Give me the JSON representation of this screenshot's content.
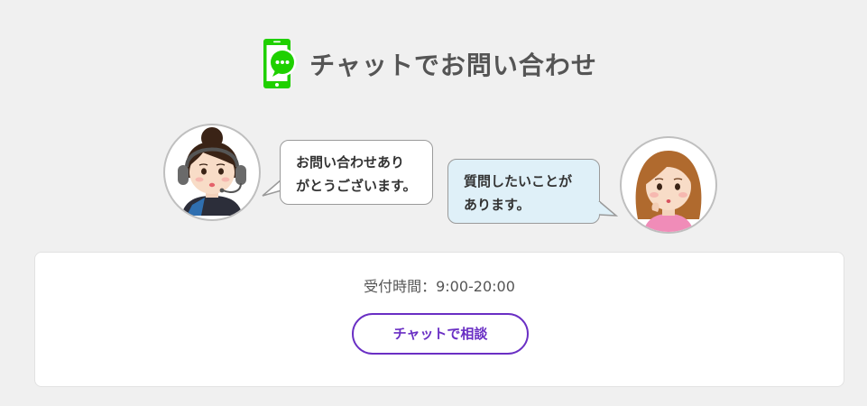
{
  "header": {
    "title": "チャットでお問い合わせ",
    "icon": "chat-phone-icon",
    "icon_color": "#1fd000"
  },
  "conversation": {
    "operator": {
      "avatar": "operator-avatar",
      "message_line1": "お問い合わせあり",
      "message_line2": "がとうございます。"
    },
    "customer": {
      "avatar": "customer-avatar",
      "message_line1": "質問したいことが",
      "message_line2": "あります。",
      "bubble_color": "#dff0f8"
    }
  },
  "card": {
    "hours": "受付時間：9:00-20:00",
    "button_label": "チャットで相談",
    "accent_color": "#6a2fc4"
  }
}
